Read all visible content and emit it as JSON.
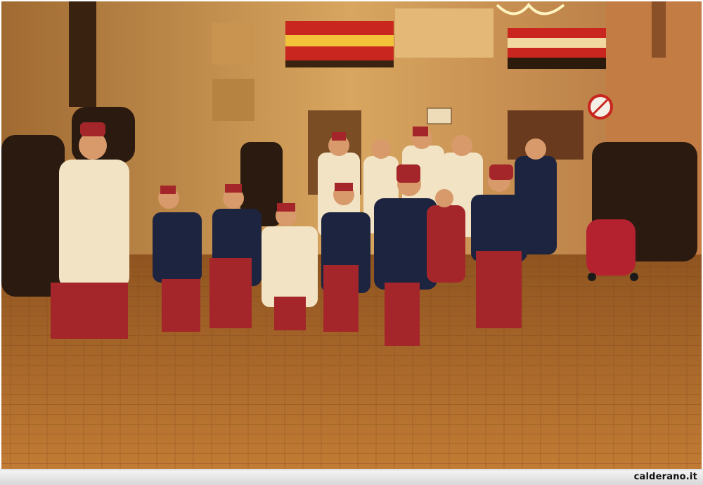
{
  "photo": {
    "description_icon": "photo-image",
    "colors": {
      "street": "#b5722e",
      "wall": "#d9a25a",
      "wall_shadow": "#6a4020",
      "costume_red": "#a4262a",
      "costume_navy": "#1c2440",
      "scarf_cream": "#f1e3c4",
      "flag_red": "#c8261e",
      "flag_yellow": "#f2c23a"
    }
  },
  "caption": {
    "site_label": "calderano.it"
  }
}
